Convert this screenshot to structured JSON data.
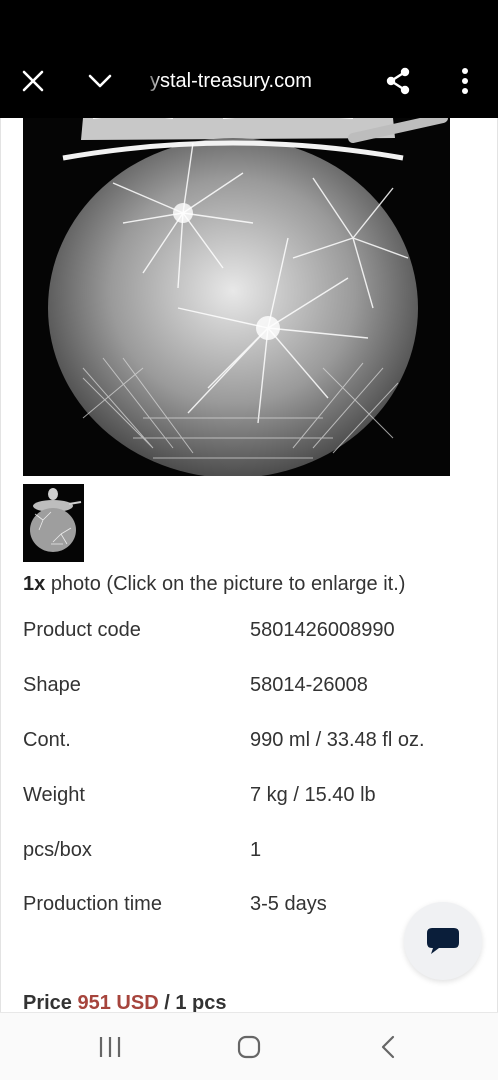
{
  "browser": {
    "url": "ystal-treasury.com",
    "icons": [
      "close-icon",
      "chevron-down-icon",
      "share-icon",
      "more-vert-icon"
    ]
  },
  "product": {
    "photo_count": "1x",
    "photo_note": "photo (Click on the picture to enlarge it.)",
    "specs": [
      {
        "label": "Product code",
        "value": "5801426008990"
      },
      {
        "label": "Shape",
        "value": "58014-26008"
      },
      {
        "label": "Cont.",
        "value": "990 ml / 33.48 fl oz."
      },
      {
        "label": "Weight",
        "value": "7 kg / 15.40 lb"
      },
      {
        "label": "pcs/box",
        "value": "1"
      },
      {
        "label": "Production time",
        "value": "3-5 days"
      }
    ],
    "price": {
      "label": "Price",
      "amount": "951 USD",
      "unit": "/ 1 pcs",
      "amount_color": "#a6443c"
    }
  },
  "chat": {
    "icon": "chat-bubble-icon"
  },
  "system_nav": {
    "icons": [
      "recent-apps-icon",
      "home-icon",
      "back-icon"
    ]
  }
}
